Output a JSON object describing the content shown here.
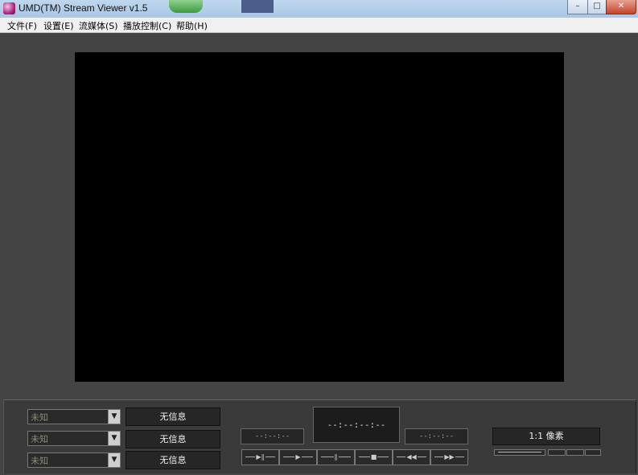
{
  "window": {
    "title": "UMD(TM) Stream Viewer v1.5",
    "buttons": {
      "minimize": "–",
      "maximize": "□",
      "close": "✕"
    }
  },
  "menu": [
    {
      "label": "文件(F)"
    },
    {
      "label": "设置(E)"
    },
    {
      "label": "流媒体(S)"
    },
    {
      "label": "播放控制(C)"
    },
    {
      "label": "帮助(H)"
    }
  ],
  "combos": [
    {
      "value": "未知"
    },
    {
      "value": "未知"
    },
    {
      "value": "未知"
    }
  ],
  "info_boxes": [
    {
      "text": "无信息"
    },
    {
      "text": "无信息"
    },
    {
      "text": "无信息"
    }
  ],
  "time": {
    "left": "--:--:--",
    "center": "--:--:--:--",
    "right": "--:--:--"
  },
  "zoom_label": "1:1 像素",
  "colors": {
    "titlebar": "#bfd7ee",
    "panel": "#3a3a3a",
    "video": "#000000"
  }
}
